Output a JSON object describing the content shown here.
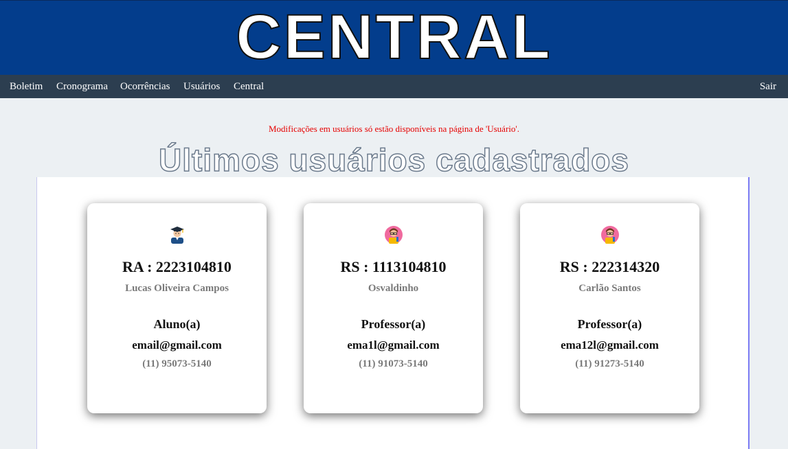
{
  "header": {
    "title": "CENTRAL"
  },
  "nav": {
    "items": [
      "Boletim",
      "Cronograma",
      "Ocorrências",
      "Usuários",
      "Central"
    ],
    "logout": "Sair"
  },
  "main": {
    "notice": "Modificações em usuários só estão disponíveis na página de 'Usuário'.",
    "heading": "Últimos usuários cadastrados",
    "cards": [
      {
        "icon": "student-avatar-icon",
        "id": "RA : 2223104810",
        "name": "Lucas Oliveira Campos",
        "role": "Aluno(a)",
        "email": "email@gmail.com",
        "phone": "(11) 95073-5140"
      },
      {
        "icon": "teacher-avatar-icon",
        "id": "RS : 1113104810",
        "name": "Osvaldinho",
        "role": "Professor(a)",
        "email": "ema1l@gmail.com",
        "phone": "(11) 91073-5140"
      },
      {
        "icon": "teacher-avatar-icon",
        "id": "RS : 222314320",
        "name": "Carlão Santos",
        "role": "Professor(a)",
        "email": "ema12l@gmail.com",
        "phone": "(11) 91273-5140"
      }
    ]
  },
  "colors": {
    "banner": "#033d8c",
    "navbar": "#2c3e50",
    "notice": "#e60000",
    "background": "#ecf0f3"
  }
}
